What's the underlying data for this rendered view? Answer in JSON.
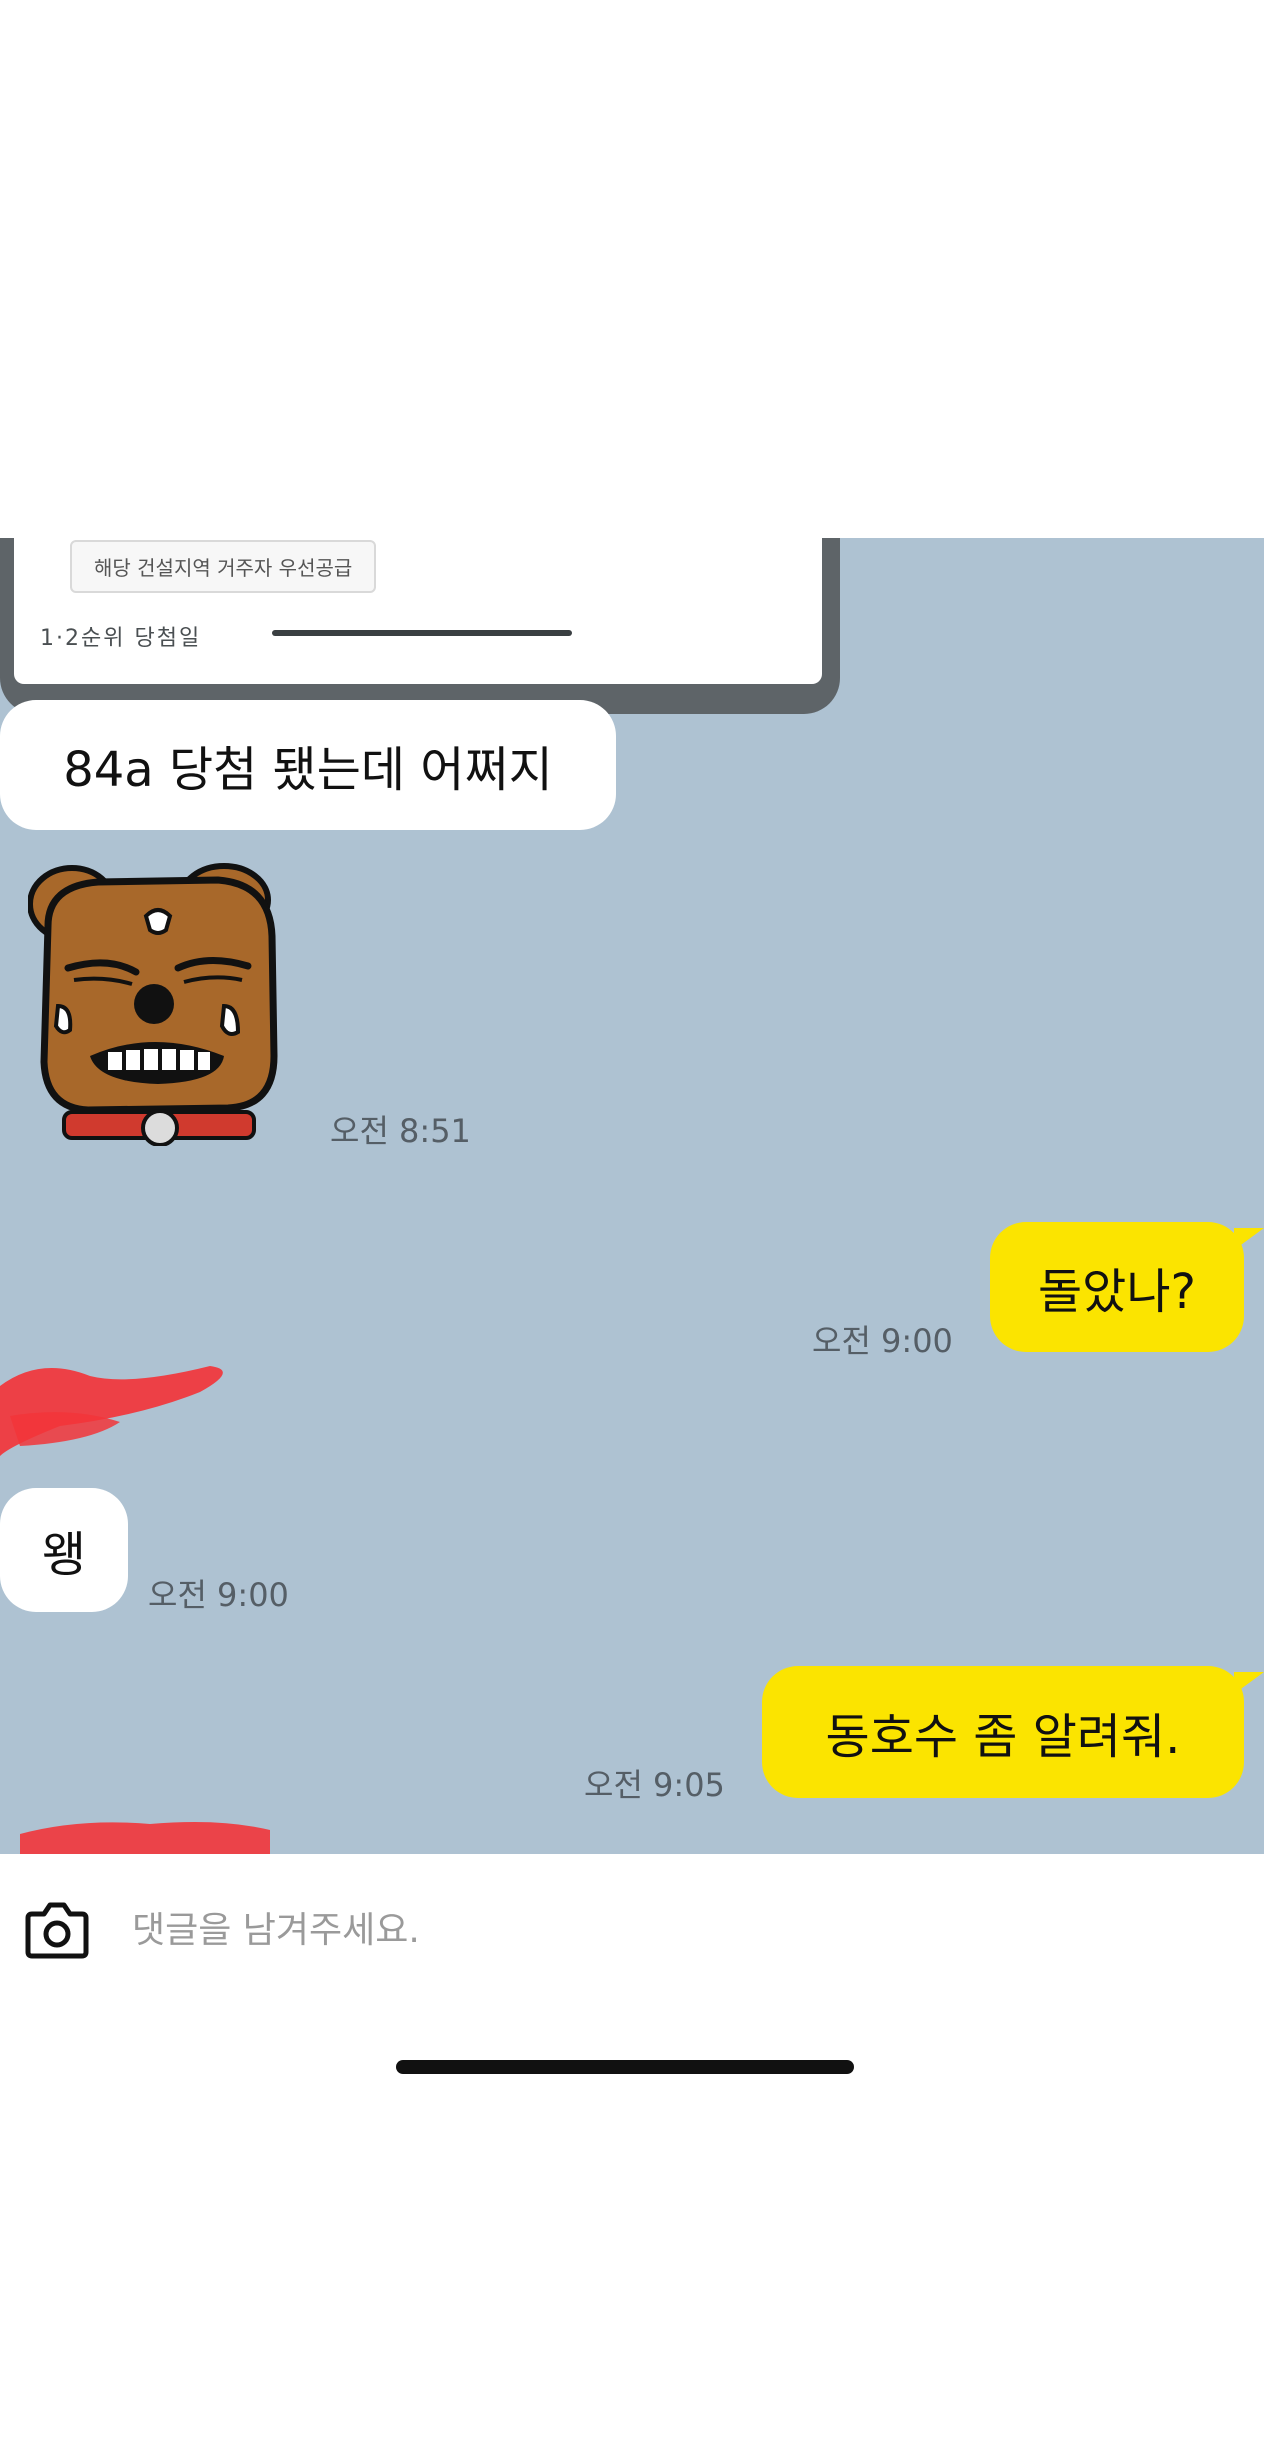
{
  "previous_card": {
    "tag_label": "해당 건설지역 거주자 우선공급",
    "cut_text": "1·2순위 당첨일"
  },
  "messages": [
    {
      "side": "in",
      "text": "84a 당첨 됐는데 어쩌지"
    },
    {
      "side": "in",
      "type": "sticker",
      "sticker": "frowning-dog-character",
      "time": "오전 8:51"
    },
    {
      "side": "out",
      "text": "돌았나?",
      "time": "오전 9:00"
    },
    {
      "side": "in",
      "text": "왱",
      "time": "오전 9:00"
    },
    {
      "side": "out",
      "text": "동호수 좀 알려줘.",
      "time": "오전 9:05"
    }
  ],
  "comment": {
    "placeholder": "댓글을 남겨주세요.",
    "value": "",
    "camera_icon": "camera-icon"
  },
  "colors": {
    "chat_background": "#aec2d2",
    "incoming_bubble": "#ffffff",
    "outgoing_bubble": "#fbe400",
    "redaction": "#f2353a"
  }
}
